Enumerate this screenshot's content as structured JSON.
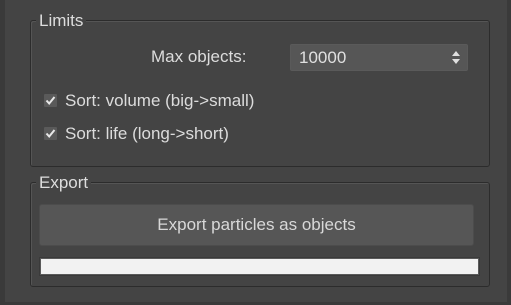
{
  "limits": {
    "title": "Limits",
    "max_objects_label": "Max objects:",
    "max_objects_value": "10000",
    "sort_volume": {
      "label": "Sort: volume (big->small)",
      "checked": true
    },
    "sort_life": {
      "label": "Sort: life (long->short)",
      "checked": true
    }
  },
  "export": {
    "title": "Export",
    "button_label": "Export particles as objects",
    "progress_fraction": 1.0
  },
  "colors": {
    "panel_bg": "#444444",
    "control_bg": "#565656",
    "text": "#dcdcdc",
    "progress_fill": "#f2f2f2"
  }
}
